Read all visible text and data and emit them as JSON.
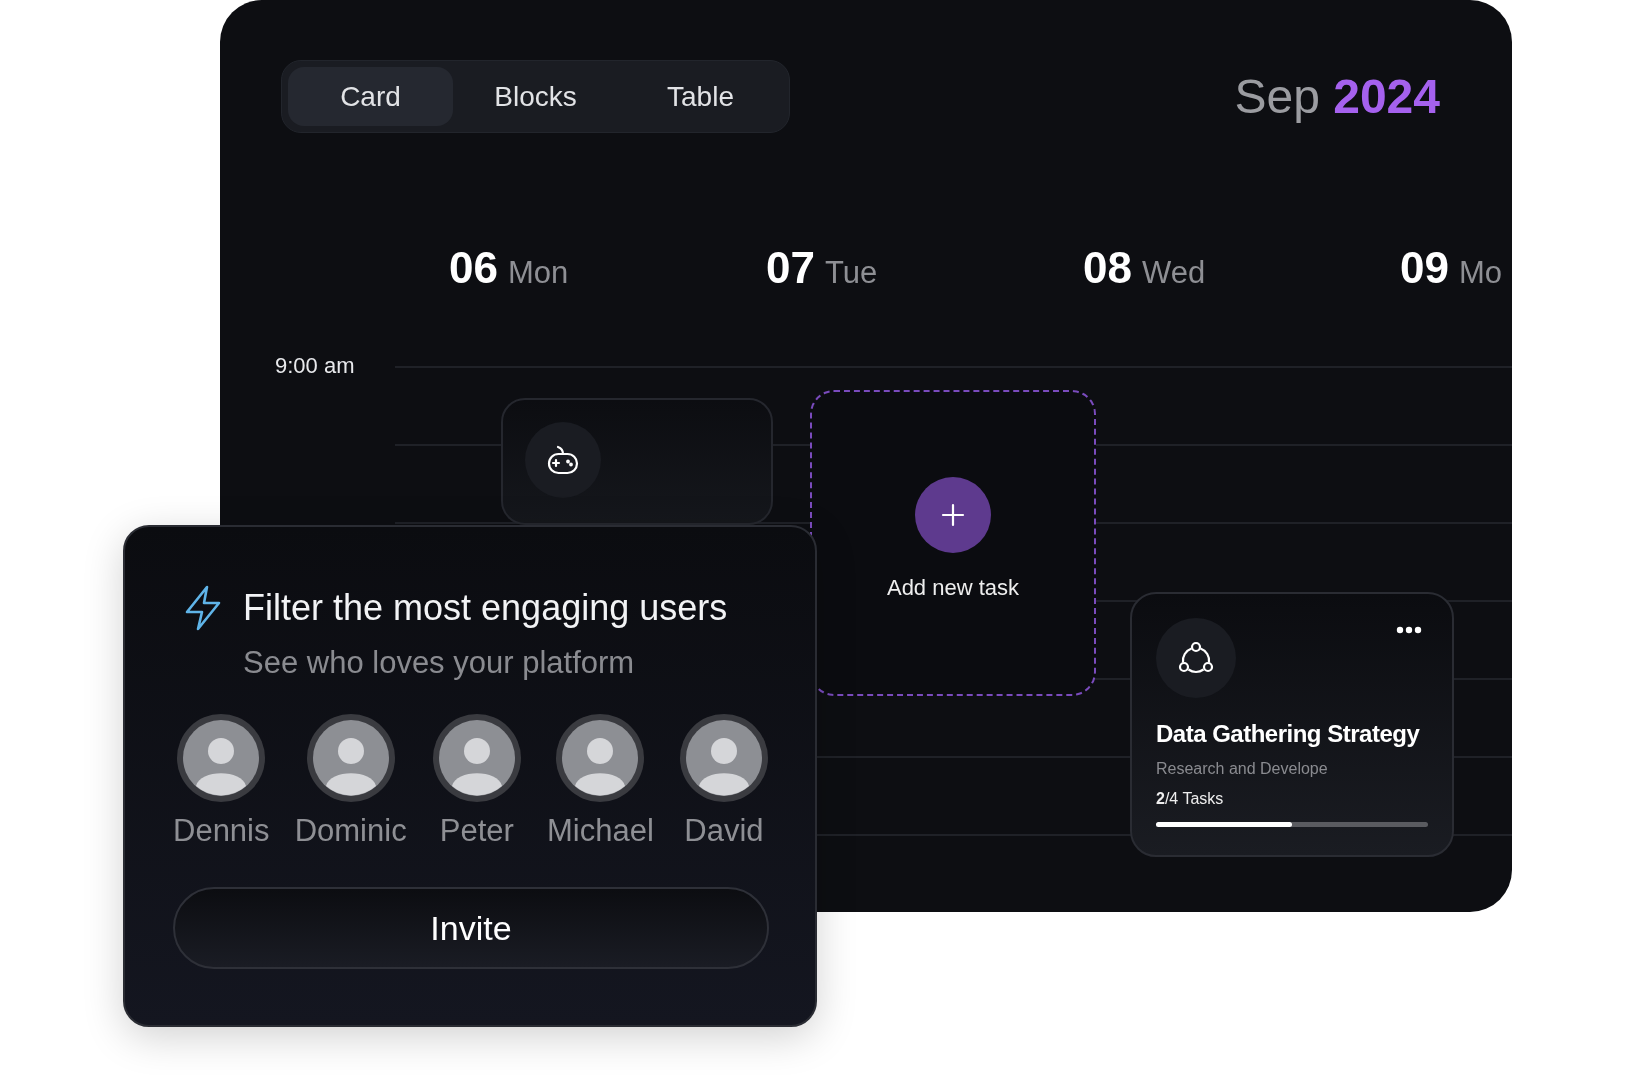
{
  "view_tabs": [
    {
      "label": "Card",
      "selected": true
    },
    {
      "label": "Blocks",
      "selected": false
    },
    {
      "label": "Table",
      "selected": false
    }
  ],
  "month": {
    "name": "Sep",
    "year": "2024"
  },
  "days": [
    {
      "number": "06",
      "weekday": "Mon"
    },
    {
      "number": "07",
      "weekday": "Tue"
    },
    {
      "number": "08",
      "weekday": "Wed"
    },
    {
      "number": "09",
      "weekday": "Mo"
    }
  ],
  "time_slots": [
    "9:00 am"
  ],
  "add_task": {
    "label": "Add new task"
  },
  "task_card": {
    "title": "Data Gathering Strategy",
    "subtitle": "Research and Develope",
    "progress": "**2**/4 Tasks",
    "level": 0.5
  },
  "invite_card": {
    "title": "Filter the most engaging users",
    "subtitle": "See who loves your platform",
    "users": [
      {
        "name": "Dennis"
      },
      {
        "name": "Dominic"
      },
      {
        "name": "Peter"
      },
      {
        "name": "Michael"
      },
      {
        "name": "David"
      }
    ],
    "button": "Invite"
  }
}
